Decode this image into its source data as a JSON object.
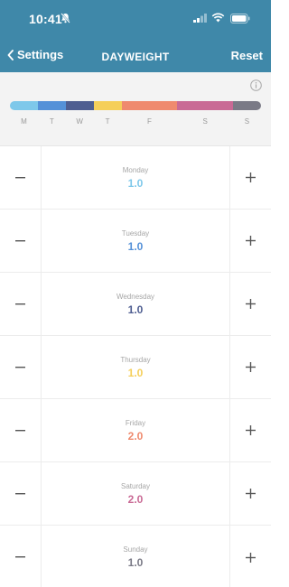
{
  "status_bar": {
    "time": "10:41",
    "icons": [
      "bell-off-icon",
      "signal-icon",
      "wifi-icon",
      "battery-icon"
    ]
  },
  "nav": {
    "back_label": "Settings",
    "title": "DAYWEIGHT",
    "reset_label": "Reset",
    "info_icon": "info-icon"
  },
  "colors": {
    "header": "#3f88a9",
    "monday": "#7ec8ea",
    "tuesday": "#5591d8",
    "wednesday": "#4f5e91",
    "thursday": "#f5cf5a",
    "friday": "#ef8a6e",
    "saturday": "#c96a95",
    "sunday": "#7a7a86"
  },
  "week_bar": {
    "labels": [
      "M",
      "T",
      "W",
      "T",
      "F",
      "S",
      "S"
    ],
    "weights": [
      1.0,
      1.0,
      1.0,
      1.0,
      2.0,
      2.0,
      1.0
    ]
  },
  "days": [
    {
      "name": "Monday",
      "value": "1.0",
      "color": "#7ec8ea"
    },
    {
      "name": "Tuesday",
      "value": "1.0",
      "color": "#5591d8"
    },
    {
      "name": "Wednesday",
      "value": "1.0",
      "color": "#4f5e91"
    },
    {
      "name": "Thursday",
      "value": "1.0",
      "color": "#f5cf5a"
    },
    {
      "name": "Friday",
      "value": "2.0",
      "color": "#ef8a6e"
    },
    {
      "name": "Saturday",
      "value": "2.0",
      "color": "#c96a95"
    },
    {
      "name": "Sunday",
      "value": "1.0",
      "color": "#7a7a86"
    }
  ],
  "controls": {
    "decrement_icon": "minus-icon",
    "increment_icon": "plus-icon"
  }
}
